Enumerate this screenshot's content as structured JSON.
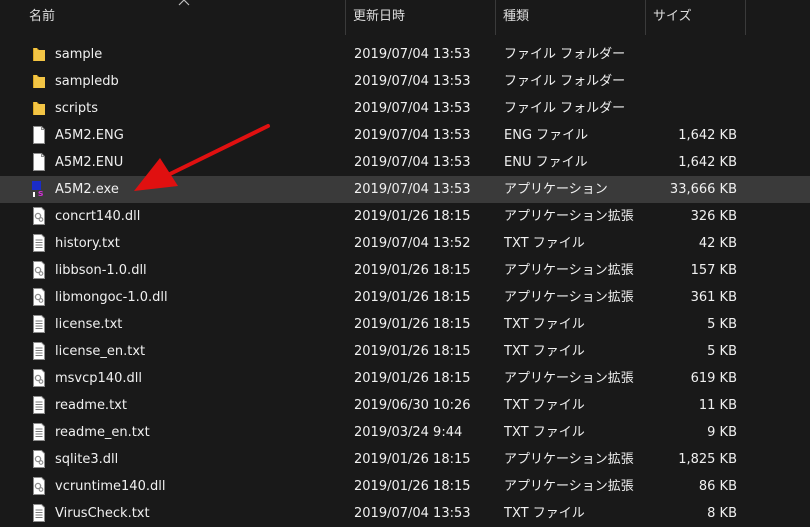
{
  "columns": {
    "name": "名前",
    "date": "更新日時",
    "type": "種類",
    "size": "サイズ"
  },
  "files": [
    {
      "name": "sample",
      "date": "2019/07/04 13:53",
      "type": "ファイル フォルダー",
      "size": "",
      "icon": "folder-icon"
    },
    {
      "name": "sampledb",
      "date": "2019/07/04 13:53",
      "type": "ファイル フォルダー",
      "size": "",
      "icon": "folder-icon"
    },
    {
      "name": "scripts",
      "date": "2019/07/04 13:53",
      "type": "ファイル フォルダー",
      "size": "",
      "icon": "folder-icon"
    },
    {
      "name": "A5M2.ENG",
      "date": "2019/07/04 13:53",
      "type": "ENG ファイル",
      "size": "1,642 KB",
      "icon": "file-icon"
    },
    {
      "name": "A5M2.ENU",
      "date": "2019/07/04 13:53",
      "type": "ENU ファイル",
      "size": "1,642 KB",
      "icon": "file-icon"
    },
    {
      "name": "A5M2.exe",
      "date": "2019/07/04 13:53",
      "type": "アプリケーション",
      "size": "33,666 KB",
      "icon": "a5m2-app-icon",
      "selected": true
    },
    {
      "name": "concrt140.dll",
      "date": "2019/01/26 18:15",
      "type": "アプリケーション拡張",
      "size": "326 KB",
      "icon": "dll-icon"
    },
    {
      "name": "history.txt",
      "date": "2019/07/04 13:52",
      "type": "TXT ファイル",
      "size": "42 KB",
      "icon": "text-file-icon"
    },
    {
      "name": "libbson-1.0.dll",
      "date": "2019/01/26 18:15",
      "type": "アプリケーション拡張",
      "size": "157 KB",
      "icon": "dll-icon"
    },
    {
      "name": "libmongoc-1.0.dll",
      "date": "2019/01/26 18:15",
      "type": "アプリケーション拡張",
      "size": "361 KB",
      "icon": "dll-icon"
    },
    {
      "name": "license.txt",
      "date": "2019/01/26 18:15",
      "type": "TXT ファイル",
      "size": "5 KB",
      "icon": "text-file-icon"
    },
    {
      "name": "license_en.txt",
      "date": "2019/01/26 18:15",
      "type": "TXT ファイル",
      "size": "5 KB",
      "icon": "text-file-icon"
    },
    {
      "name": "msvcp140.dll",
      "date": "2019/01/26 18:15",
      "type": "アプリケーション拡張",
      "size": "619 KB",
      "icon": "dll-icon"
    },
    {
      "name": "readme.txt",
      "date": "2019/06/30 10:26",
      "type": "TXT ファイル",
      "size": "11 KB",
      "icon": "text-file-icon"
    },
    {
      "name": "readme_en.txt",
      "date": "2019/03/24 9:44",
      "type": "TXT ファイル",
      "size": "9 KB",
      "icon": "text-file-icon"
    },
    {
      "name": "sqlite3.dll",
      "date": "2019/01/26 18:15",
      "type": "アプリケーション拡張",
      "size": "1,825 KB",
      "icon": "dll-icon"
    },
    {
      "name": "vcruntime140.dll",
      "date": "2019/01/26 18:15",
      "type": "アプリケーション拡張",
      "size": "86 KB",
      "icon": "dll-icon"
    },
    {
      "name": "VirusCheck.txt",
      "date": "2019/07/04 13:53",
      "type": "TXT ファイル",
      "size": "8 KB",
      "icon": "text-file-icon"
    }
  ],
  "colors": {
    "background": "#191919",
    "selected_row": "#3a3a3a",
    "folder": "#f3c545",
    "annotation_arrow": "#e01010"
  }
}
